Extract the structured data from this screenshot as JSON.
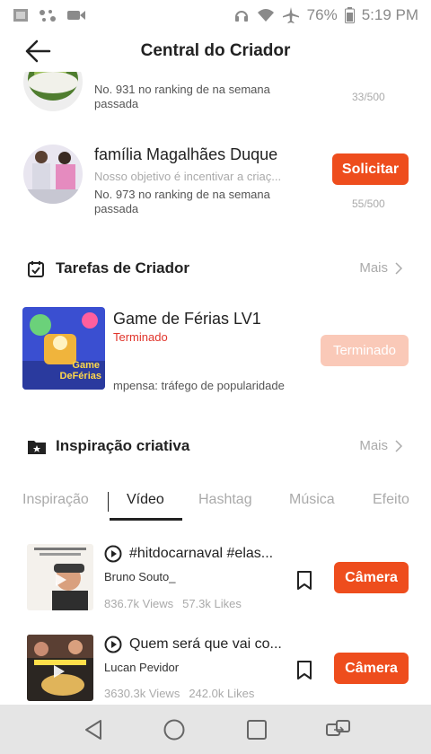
{
  "status_bar": {
    "battery": "76%",
    "time": "5:19 PM"
  },
  "header": {
    "title": "Central do Criador"
  },
  "ranking": [
    {
      "name": "",
      "description": "",
      "position": "No. 931 no ranking de na semana passada",
      "count": "33/500"
    },
    {
      "name": "família Magalhães Duque",
      "description": "Nosso objetivo é incentivar a criaç...",
      "position": "No. 973 no ranking de na semana passada",
      "count": "55/500",
      "button": "Solicitar"
    }
  ],
  "tasks": {
    "title": "Tarefas de Criador",
    "more": "Mais",
    "item": {
      "name": "Game de Férias LV1",
      "status": "Terminado",
      "reward": "mpensa: tráfego de popularidade",
      "button": "Terminado",
      "thumb_text": "Game De Férias"
    }
  },
  "inspiration": {
    "title": "Inspiração criativa",
    "more": "Mais",
    "tabs": [
      "Inspiração",
      "Vídeo",
      "Hashtag",
      "Música",
      "Efeito"
    ],
    "active_tab": "Vídeo"
  },
  "videos": [
    {
      "title": "#hitdocarnaval #elas...",
      "author": "Bruno Souto_",
      "views": "836.7k Views",
      "likes": "57.3k Likes",
      "button": "Câmera"
    },
    {
      "title": "Quem será que vai co...",
      "author": "Lucan Pevidor",
      "views": "3630.3k Views",
      "likes": "242.0k Likes",
      "button": "Câmera"
    }
  ],
  "colors": {
    "accent": "#ee4d1d",
    "status_red": "#e0342b",
    "muted": "#aaaaaa"
  }
}
